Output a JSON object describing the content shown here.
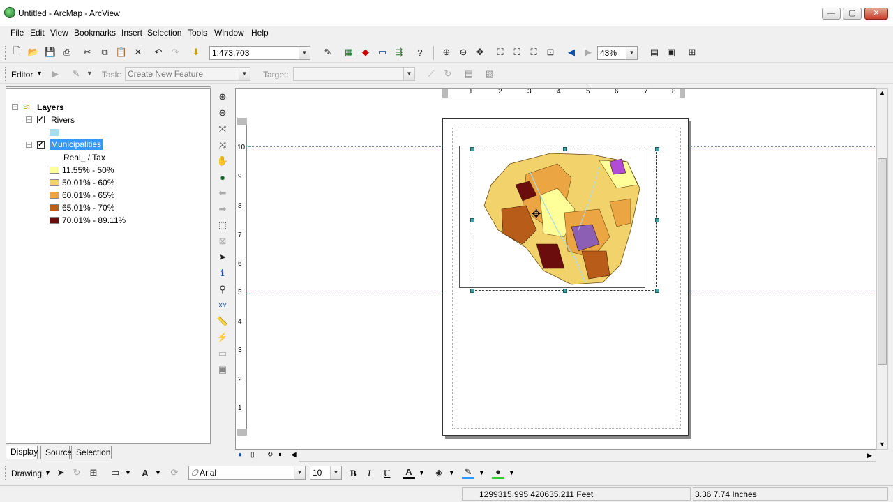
{
  "window": {
    "title": "Untitled - ArcMap - ArcView",
    "controls": {
      "minimize": "—",
      "maximize": "▢",
      "close": "✕"
    }
  },
  "menu": [
    "File",
    "Edit",
    "View",
    "Bookmarks",
    "Insert",
    "Selection",
    "Tools",
    "Window",
    "Help"
  ],
  "standard_toolbar": {
    "scale_value": "1:473,703",
    "zoom_value": "43%"
  },
  "editor_toolbar": {
    "editor_label": "Editor",
    "task_label": "Task:",
    "task_value": "Create New Feature",
    "target_label": "Target:",
    "target_value": ""
  },
  "toc": {
    "root": "Layers",
    "layers": [
      {
        "name": "Rivers",
        "checked": true,
        "legend": [
          {
            "label": "",
            "color": "#a6dcef"
          }
        ]
      },
      {
        "name": "Municipalities",
        "checked": true,
        "selected": true,
        "field": "Real_ / Tax",
        "legend": [
          {
            "label": "11.55% - 50%",
            "color": "#ffff99"
          },
          {
            "label": "50.01% - 60%",
            "color": "#f2d36b"
          },
          {
            "label": "60.01% - 65%",
            "color": "#eba542"
          },
          {
            "label": "65.01% - 70%",
            "color": "#b85c1a"
          },
          {
            "label": "70.01% - 89.11%",
            "color": "#6b0d0d"
          }
        ]
      }
    ],
    "tabs": [
      "Display",
      "Source",
      "Selection"
    ]
  },
  "ruler": {
    "horizontal": [
      "1",
      "2",
      "3",
      "4",
      "5",
      "6",
      "7",
      "8"
    ],
    "vertical": [
      "10",
      "9",
      "8",
      "7",
      "6",
      "5",
      "4",
      "3",
      "2",
      "1"
    ]
  },
  "drawing_toolbar": {
    "drawing_label": "Drawing",
    "font_name": "Arial",
    "font_size": "10",
    "bold": "B",
    "italic": "I",
    "underline": "U"
  },
  "status": {
    "coordinates": "1299315.995  420635.211 Feet",
    "page_position": "3.36  7.74 Inches"
  },
  "colors": {
    "selection_highlight": "#3399ff",
    "handle": "#3fa3a3"
  }
}
